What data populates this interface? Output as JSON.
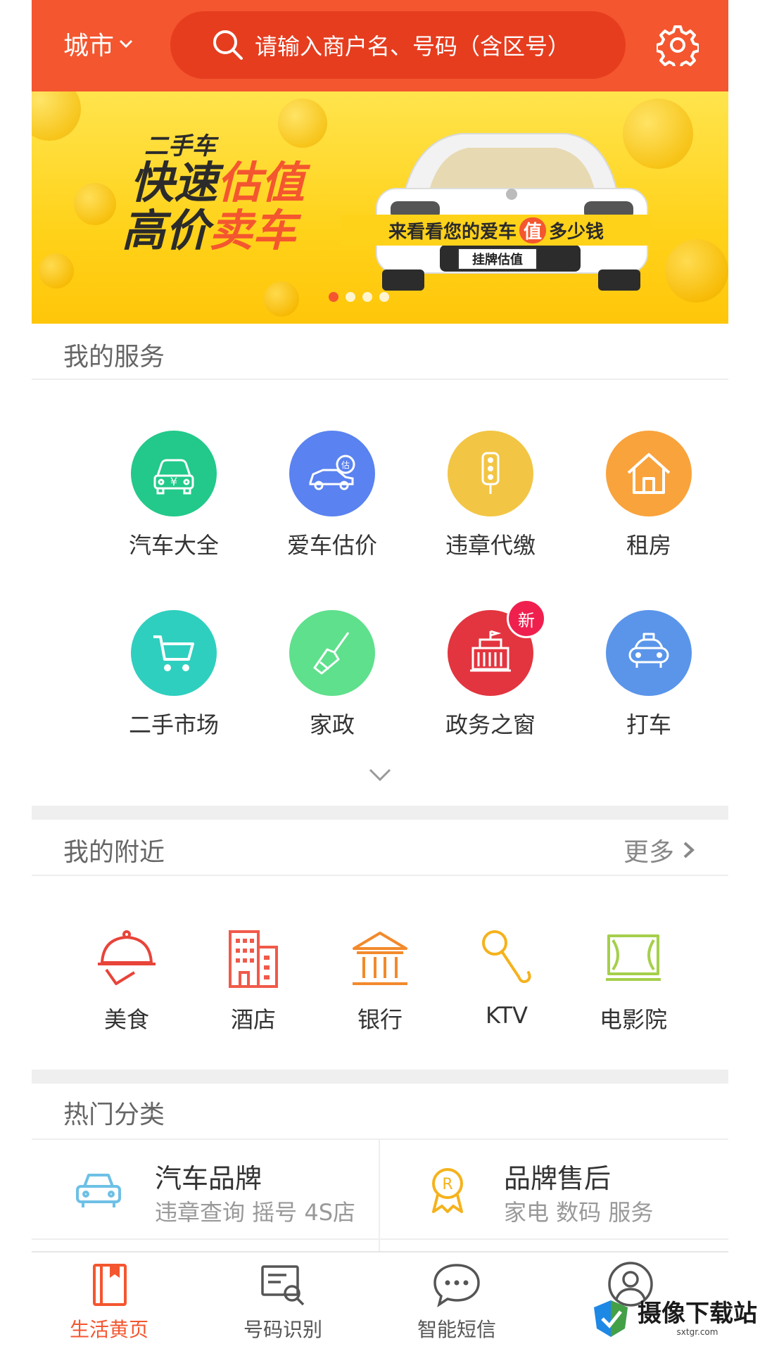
{
  "header": {
    "city_label": "城市",
    "search_placeholder": "请输入商户名、号码（含区号）"
  },
  "banner": {
    "line1": "二手车",
    "line2_a": "快速",
    "line2_b": "估值",
    "line3_a": "高价",
    "line3_b": "卖车",
    "strip_a": "来看看您的爱车",
    "strip_value": "值",
    "strip_b": "多少钱",
    "plate": "挂牌估值",
    "page_count": 4,
    "active_page": 1
  },
  "services": {
    "title": "我的服务",
    "items": [
      {
        "label": "汽车大全",
        "icon": "car-yuan-icon",
        "color": "#22c98a"
      },
      {
        "label": "爱车估价",
        "icon": "car-estimate-icon",
        "color": "#5a82f0"
      },
      {
        "label": "违章代缴",
        "icon": "traffic-light-icon",
        "color": "#f2c544"
      },
      {
        "label": "租房",
        "icon": "house-icon",
        "color": "#f9a33c"
      },
      {
        "label": "二手市场",
        "icon": "shopping-cart-icon",
        "color": "#2fcfbf"
      },
      {
        "label": "家政",
        "icon": "broom-icon",
        "color": "#5fe08c"
      },
      {
        "label": "政务之窗",
        "icon": "government-building-icon",
        "color": "#e3353f",
        "badge": "新"
      },
      {
        "label": "打车",
        "icon": "taxi-icon",
        "color": "#5a95ea"
      }
    ]
  },
  "nearby": {
    "title": "我的附近",
    "more_label": "更多",
    "items": [
      {
        "label": "美食",
        "icon": "food-cloche-icon",
        "color": "#e8443a"
      },
      {
        "label": "酒店",
        "icon": "hotel-building-icon",
        "color": "#f05a4a"
      },
      {
        "label": "银行",
        "icon": "bank-icon",
        "color": "#f28a2c"
      },
      {
        "label": "KTV",
        "icon": "microphone-icon",
        "color": "#f5b21c"
      },
      {
        "label": "电影院",
        "icon": "cinema-screen-icon",
        "color": "#a5cf4c"
      }
    ]
  },
  "hot": {
    "title": "热门分类",
    "cards": [
      {
        "title": "汽车品牌",
        "subtitle": "违章查询 摇号 4S店",
        "icon": "car-outline-icon"
      },
      {
        "title": "品牌售后",
        "subtitle": "家电 数码 服务",
        "icon": "registered-medal-icon"
      }
    ]
  },
  "bottom_nav": {
    "items": [
      {
        "label": "生活黄页",
        "icon": "book-icon",
        "active": true
      },
      {
        "label": "号码识别",
        "icon": "card-search-icon",
        "active": false
      },
      {
        "label": "智能短信",
        "icon": "chat-bubble-icon",
        "active": false
      },
      {
        "label": "",
        "icon": "profile-icon",
        "active": false
      }
    ]
  },
  "watermark": {
    "text": "摄像下载站",
    "sub": "sxtgr.com"
  },
  "colors": {
    "brand": "#f4562f",
    "search_bg": "#e63d1f",
    "banner_yellow": "#ffd21a"
  }
}
